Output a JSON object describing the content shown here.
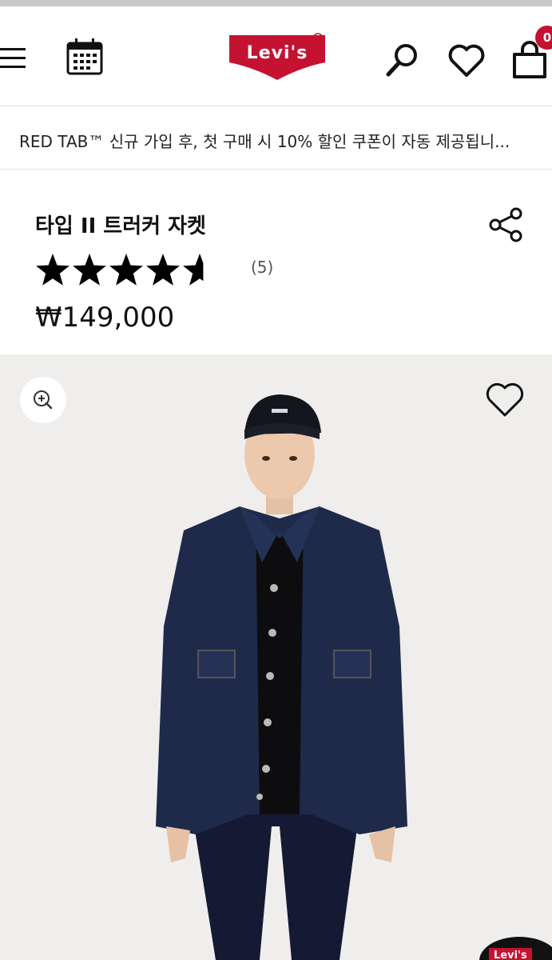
{
  "header": {
    "brand": "Levi's",
    "cart_count": "0",
    "icons": [
      "menu-icon",
      "calendar-icon",
      "search-icon",
      "heart-icon",
      "shopping-bag-icon"
    ]
  },
  "promo": {
    "text": "RED TAB™ 신규 가입 후, 첫 구매 시 10% 할인 쿠폰이 자동 제공됩니..."
  },
  "product": {
    "title": "타입 II 트러커 자켓",
    "rating": 4.6,
    "review_count": "(5)",
    "price": "₩149,000"
  },
  "image": {
    "corner_badge": "Levi's"
  },
  "colors": {
    "brand_red": "#c41230",
    "image_bg": "#efeeec",
    "denim": "#1f2a4a"
  }
}
